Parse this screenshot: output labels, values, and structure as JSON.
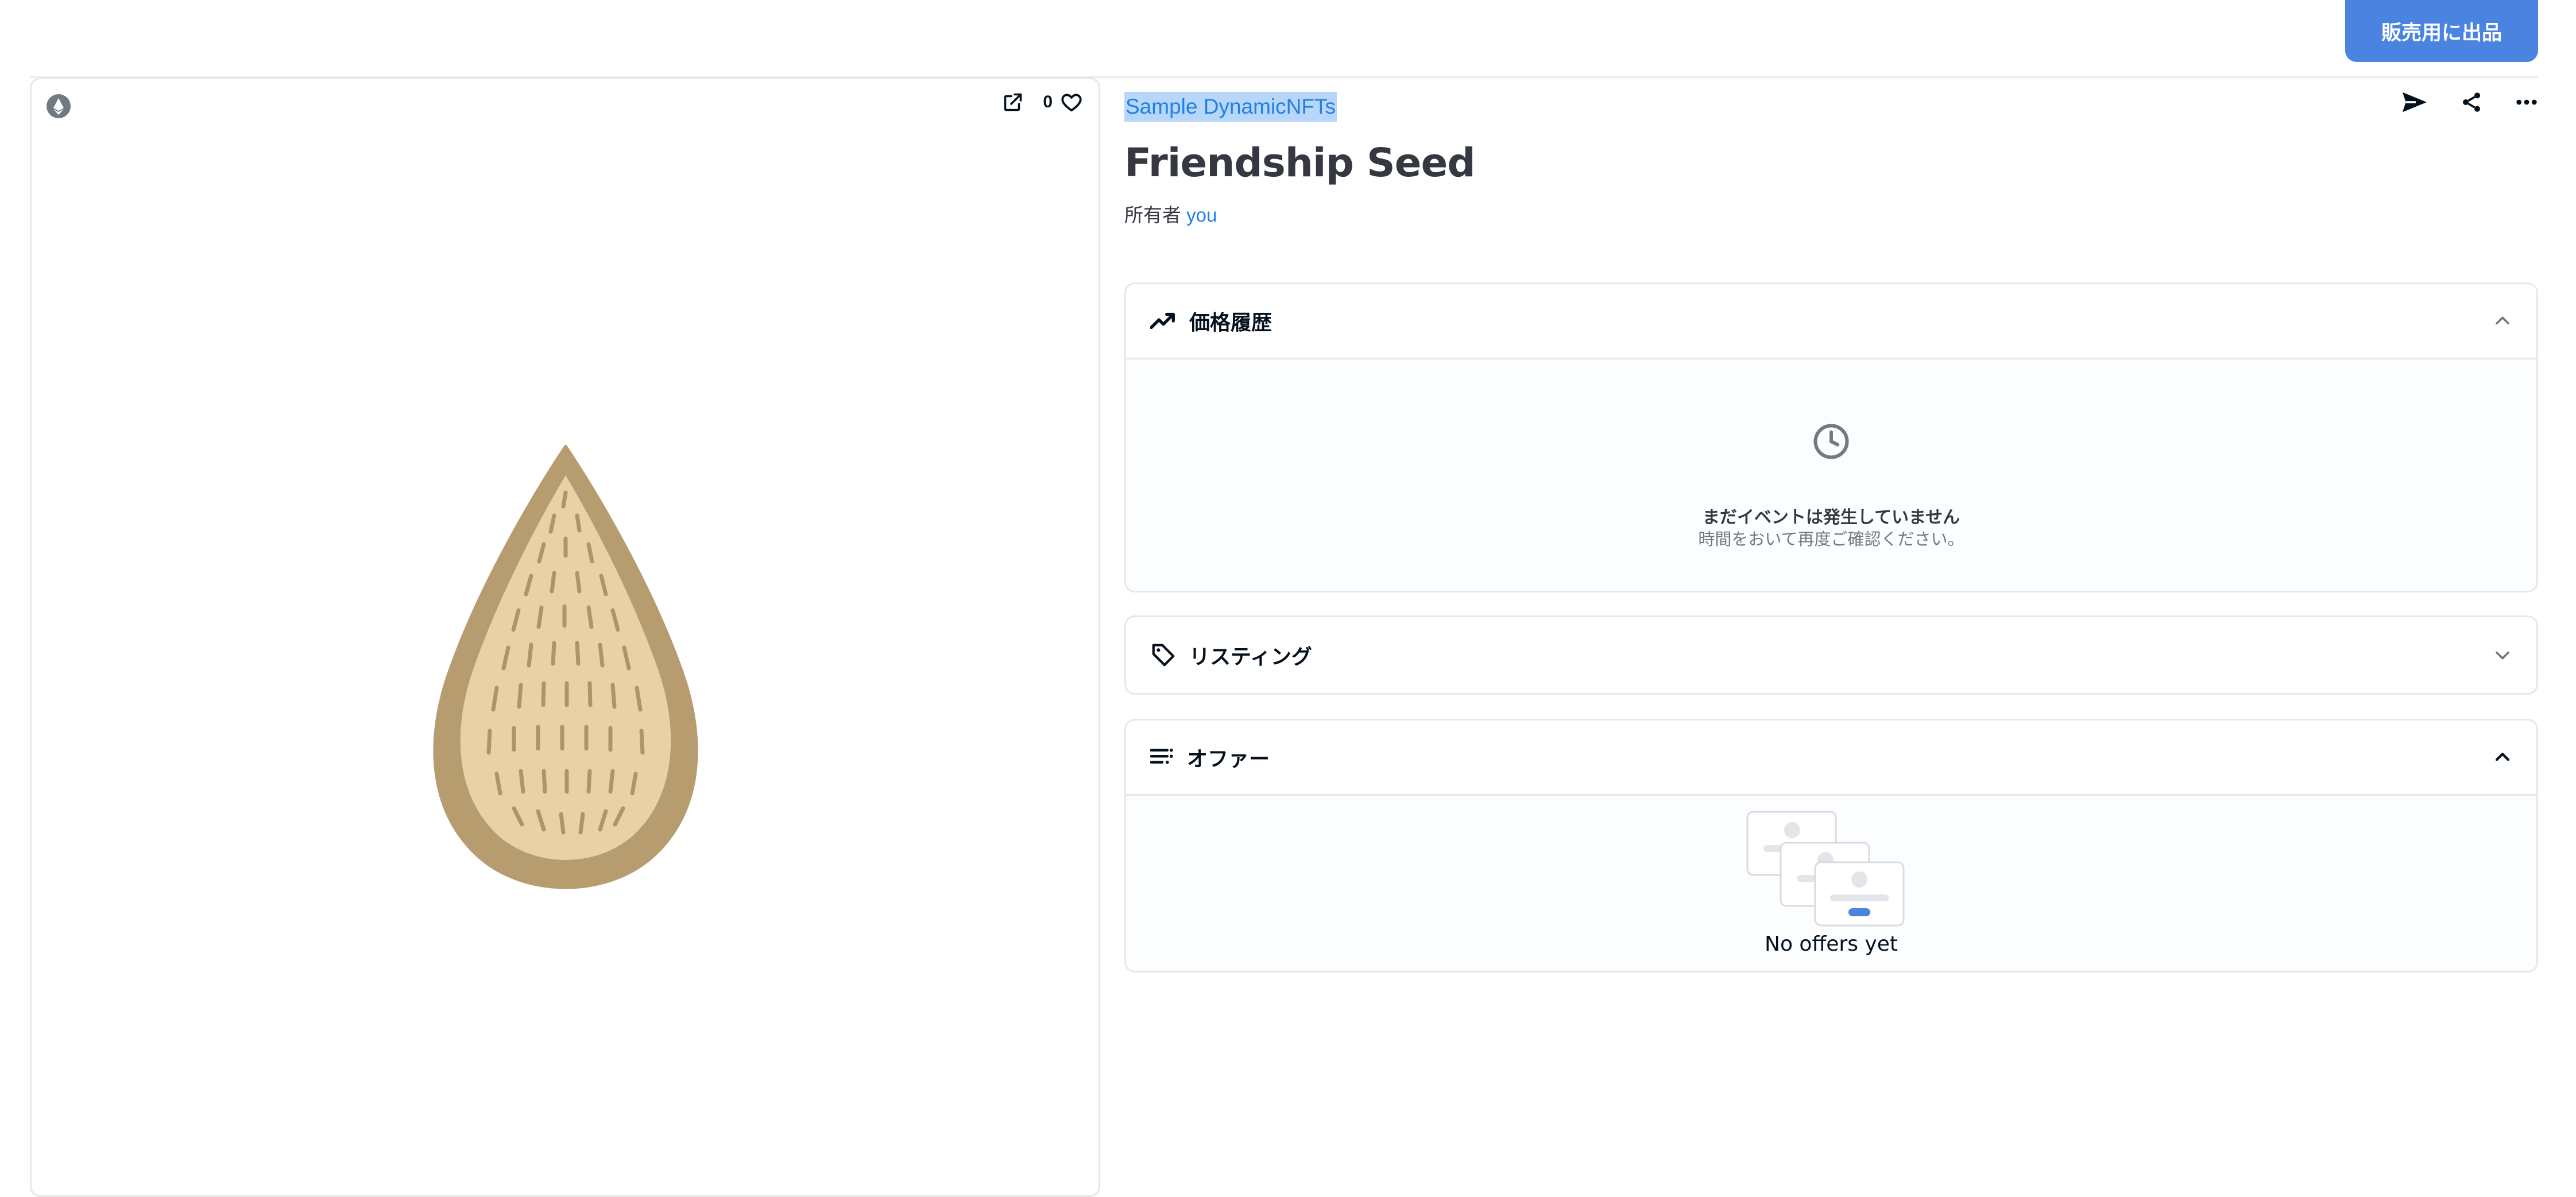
{
  "header": {
    "sell_button_label": "販売用に出品"
  },
  "media": {
    "chain_icon": "ethereum-icon",
    "open_icon": "open-external-icon",
    "favorites_count": "0",
    "favorite_icon": "heart-icon",
    "image_subject": "seed",
    "seed_colors": {
      "outer": "#b79c6f",
      "inner": "#e8d1a4",
      "marks": "#b19463"
    }
  },
  "item": {
    "collection_name": "Sample DynamicNFTs",
    "title": "Friendship Seed",
    "owner_label": "所有者",
    "owner_name": "you",
    "actions": [
      "send-icon",
      "share-icon",
      "more-icon"
    ]
  },
  "panels": {
    "price_history": {
      "title": "価格履歴",
      "icon": "trending-up-icon",
      "chevron": "chevron-up-icon",
      "empty_title": "まだイベントは発生していません",
      "empty_subtitle": "時間をおいて再度ご確認ください。"
    },
    "listings": {
      "title": "リスティング",
      "icon": "tag-icon",
      "chevron": "chevron-down-icon"
    },
    "offers": {
      "title": "オファー",
      "icon": "list-icon",
      "chevron": "chevron-up-icon",
      "empty_text": "No offers yet"
    }
  },
  "colors": {
    "accent": "#4a84e0",
    "link": "#2081e2",
    "selection": "#b8d6f9"
  }
}
